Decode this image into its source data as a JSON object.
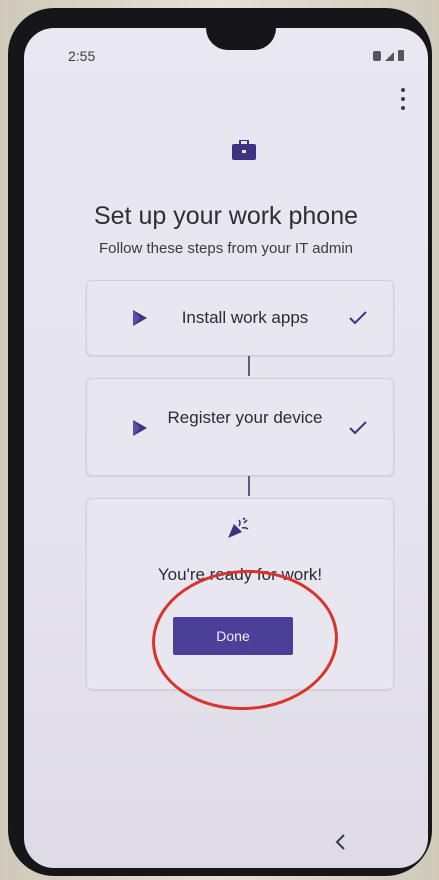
{
  "status_bar": {
    "time": "2:55"
  },
  "header": {
    "title": "Set up your work phone",
    "subtitle": "Follow these steps from your IT admin"
  },
  "steps": [
    {
      "label": "Install work apps",
      "status": "complete",
      "icon": "play-store-icon"
    },
    {
      "label": "Register your device",
      "status": "complete",
      "icon": "play-store-icon"
    }
  ],
  "ready_card": {
    "icon": "party-popper-icon",
    "message": "You're ready for work!",
    "button_label": "Done"
  },
  "colors": {
    "accent": "#4b3f9a",
    "annotation": "#d8342c"
  }
}
